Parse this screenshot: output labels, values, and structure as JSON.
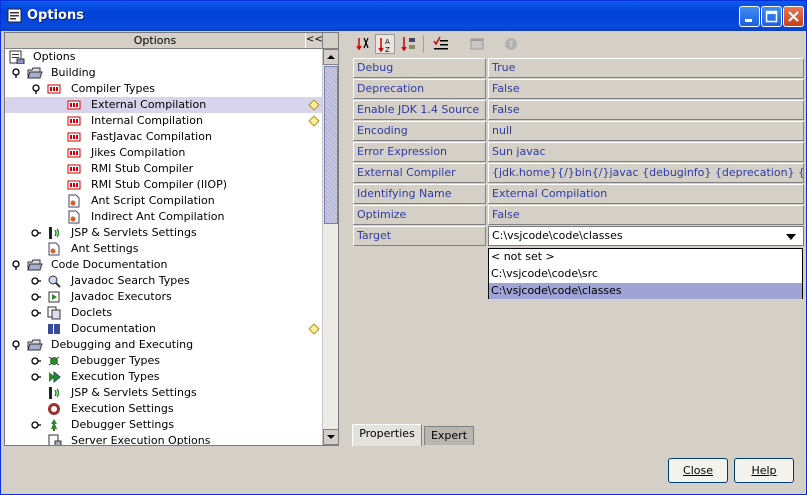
{
  "window": {
    "title": "Options"
  },
  "left": {
    "header": "Options",
    "collapse_label": "<<",
    "tree": [
      {
        "label": "Options",
        "level": 0,
        "toggle": "",
        "icon": "options-root-icon"
      },
      {
        "label": "Building",
        "level": 1,
        "toggle": "expanded",
        "icon": "folder-icon"
      },
      {
        "label": "Compiler Types",
        "level": 2,
        "toggle": "expanded",
        "icon": "compiler-types-icon"
      },
      {
        "label": "External Compilation",
        "level": 3,
        "toggle": "",
        "icon": "compiler-icon",
        "selected": true,
        "diamond": true
      },
      {
        "label": "Internal Compilation",
        "level": 3,
        "toggle": "",
        "icon": "compiler-icon",
        "diamond": true
      },
      {
        "label": "FastJavac Compilation",
        "level": 3,
        "toggle": "",
        "icon": "compiler-icon"
      },
      {
        "label": "Jikes Compilation",
        "level": 3,
        "toggle": "",
        "icon": "compiler-icon"
      },
      {
        "label": "RMI Stub Compiler",
        "level": 3,
        "toggle": "",
        "icon": "compiler-icon"
      },
      {
        "label": "RMI Stub Compiler (IIOP)",
        "level": 3,
        "toggle": "",
        "icon": "compiler-icon"
      },
      {
        "label": "Ant Script Compilation",
        "level": 3,
        "toggle": "",
        "icon": "ant-script-icon"
      },
      {
        "label": "Indirect Ant Compilation",
        "level": 3,
        "toggle": "",
        "icon": "ant-script-icon"
      },
      {
        "label": "JSP & Servlets Settings",
        "level": 2,
        "toggle": "collapsed",
        "icon": "jsp-icon"
      },
      {
        "label": "Ant Settings",
        "level": 2,
        "toggle": "",
        "icon": "ant-script-icon"
      },
      {
        "label": "Code Documentation",
        "level": 1,
        "toggle": "expanded",
        "icon": "folder-icon"
      },
      {
        "label": "Javadoc Search Types",
        "level": 2,
        "toggle": "collapsed",
        "icon": "javadoc-search-icon"
      },
      {
        "label": "Javadoc Executors",
        "level": 2,
        "toggle": "collapsed",
        "icon": "javadoc-exec-icon"
      },
      {
        "label": "Doclets",
        "level": 2,
        "toggle": "collapsed",
        "icon": "doclets-icon"
      },
      {
        "label": "Documentation",
        "level": 2,
        "toggle": "",
        "icon": "documentation-icon",
        "diamond": true
      },
      {
        "label": "Debugging and Executing",
        "level": 1,
        "toggle": "expanded",
        "icon": "folder-icon"
      },
      {
        "label": "Debugger Types",
        "level": 2,
        "toggle": "collapsed",
        "icon": "debugger-types-icon"
      },
      {
        "label": "Execution Types",
        "level": 2,
        "toggle": "collapsed",
        "icon": "execution-types-icon"
      },
      {
        "label": "JSP & Servlets Settings",
        "level": 2,
        "toggle": "",
        "icon": "jsp-icon"
      },
      {
        "label": "Execution Settings",
        "level": 2,
        "toggle": "",
        "icon": "execution-settings-icon"
      },
      {
        "label": "Debugger Settings",
        "level": 2,
        "toggle": "collapsed",
        "icon": "debugger-settings-icon"
      },
      {
        "label": "Server Execution Options",
        "level": 2,
        "toggle": "",
        "icon": "server-exec-icon"
      }
    ]
  },
  "toolbar": {
    "tools": [
      "sort-unsorted-icon",
      "sort-by-name-icon",
      "sort-by-type-icon",
      "property-list-icon",
      "customize-icon",
      "help-icon"
    ]
  },
  "properties": [
    {
      "name": "Debug",
      "value": "True"
    },
    {
      "name": "Deprecation",
      "value": "False"
    },
    {
      "name": "Enable JDK 1.4 Source",
      "value": "False"
    },
    {
      "name": "Encoding",
      "value": "null"
    },
    {
      "name": "Error Expression",
      "value": "Sun javac"
    },
    {
      "name": "External Compiler",
      "value": "{jdk.home}{/}bin{/}javac {debuginfo} {deprecation} {optimize} {out"
    },
    {
      "name": "Identifying Name",
      "value": "External Compilation"
    },
    {
      "name": "Optimize",
      "value": "False"
    },
    {
      "name": "Target",
      "value": "C:\\vsjcode\\code\\classes",
      "combo": true
    }
  ],
  "dropdown": {
    "options": [
      "< not set >",
      "C:\\vsjcode\\code\\src",
      "C:\\vsjcode\\code\\classes"
    ],
    "selected_index": 2
  },
  "tabs": [
    "Properties",
    "Expert"
  ],
  "buttons": {
    "close": "Close",
    "help": "Help"
  },
  "colors": {
    "title_bar": "#0a49dd",
    "property_text": "#2e3aa6",
    "selection": "#9fa3d6"
  }
}
